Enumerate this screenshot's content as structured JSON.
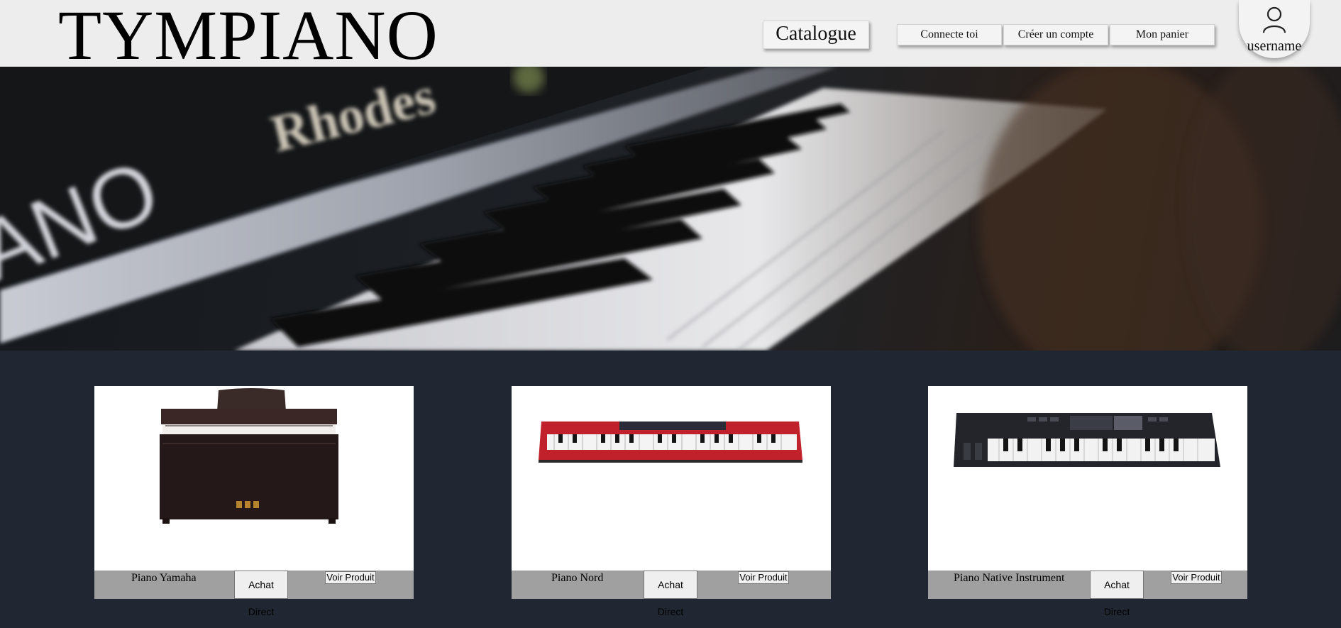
{
  "header": {
    "logo": "TYMPIANO",
    "catalogue_label": "Catalogue",
    "nav": [
      {
        "label": "Connecte toi"
      },
      {
        "label": "Créer un compte"
      },
      {
        "label": "Mon panier"
      }
    ],
    "user": {
      "name": "username",
      "icon": "user-icon"
    }
  },
  "hero": {
    "description": "Rhodes piano keyboard banner",
    "text_fragments": [
      "ANO",
      "Rhodes"
    ]
  },
  "products": [
    {
      "name": "Piano Yamaha",
      "buy_label": "Achat Direct",
      "view_label": "Voir Produit"
    },
    {
      "name": "Piano Nord",
      "buy_label": "Achat Direct",
      "view_label": "Voir Produit"
    },
    {
      "name": "Piano Native Instrument",
      "buy_label": "Achat Direct",
      "view_label": "Voir Produit"
    }
  ],
  "colors": {
    "header_bg": "#ededed",
    "page_bg": "#212732",
    "product_bar": "#a0a0a0",
    "nord_red": "#c0212b"
  }
}
